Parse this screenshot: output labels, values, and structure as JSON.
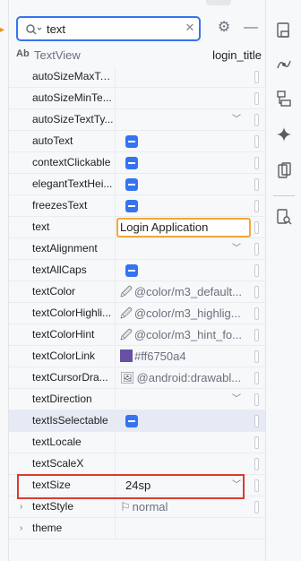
{
  "search": {
    "value": "text"
  },
  "component": {
    "type_badge": "Ab",
    "type": "TextView",
    "id": "login_title"
  },
  "attributes": [
    {
      "name": "autoSizeMaxTe...",
      "kind": "empty"
    },
    {
      "name": "autoSizeMinTe...",
      "kind": "empty"
    },
    {
      "name": "autoSizeTextTy...",
      "kind": "dropdown",
      "value": ""
    },
    {
      "name": "autoText",
      "kind": "checkbox"
    },
    {
      "name": "contextClickable",
      "kind": "checkbox"
    },
    {
      "name": "elegantTextHei...",
      "kind": "checkbox"
    },
    {
      "name": "freezesText",
      "kind": "checkbox"
    },
    {
      "name": "text",
      "kind": "text-input",
      "value": "Login Application"
    },
    {
      "name": "textAlignment",
      "kind": "dropdown",
      "value": ""
    },
    {
      "name": "textAllCaps",
      "kind": "checkbox"
    },
    {
      "name": "textColor",
      "kind": "resource",
      "icon": "pipette-icon",
      "value": "@color/m3_default..."
    },
    {
      "name": "textColorHighli...",
      "kind": "resource",
      "icon": "pipette-icon",
      "value": "@color/m3_highlig..."
    },
    {
      "name": "textColorHint",
      "kind": "resource",
      "icon": "pipette-icon",
      "value": "@color/m3_hint_fo..."
    },
    {
      "name": "textColorLink",
      "kind": "color",
      "swatch": "#6750a4",
      "value": "#ff6750a4"
    },
    {
      "name": "textCursorDra...",
      "kind": "resource",
      "icon": "image-icon",
      "value": "@android:drawabl..."
    },
    {
      "name": "textDirection",
      "kind": "dropdown",
      "value": ""
    },
    {
      "name": "textIsSelectable",
      "kind": "checkbox",
      "selected": true
    },
    {
      "name": "textLocale",
      "kind": "empty"
    },
    {
      "name": "textScaleX",
      "kind": "empty"
    },
    {
      "name": "textSize",
      "kind": "dropdown",
      "value": "24sp",
      "highlighted": true
    },
    {
      "name": "textStyle",
      "kind": "flag",
      "expandable": true,
      "value": "normal"
    },
    {
      "name": "theme",
      "kind": "empty",
      "expandable": true
    }
  ],
  "icons": {
    "search": "search-icon",
    "clear": "clear-icon",
    "settings": "gear-icon",
    "collapse": "minus-icon",
    "right_toolbar": [
      "palette-icon",
      "motion-icon",
      "component-tree-icon",
      "ai-sparkle-icon",
      "device-icon",
      "inspect-icon"
    ]
  },
  "colors": {
    "accent": "#3574f0",
    "focus_border": "#f0a83c",
    "highlight_border": "#db3b30",
    "link_swatch": "#6750a4"
  }
}
